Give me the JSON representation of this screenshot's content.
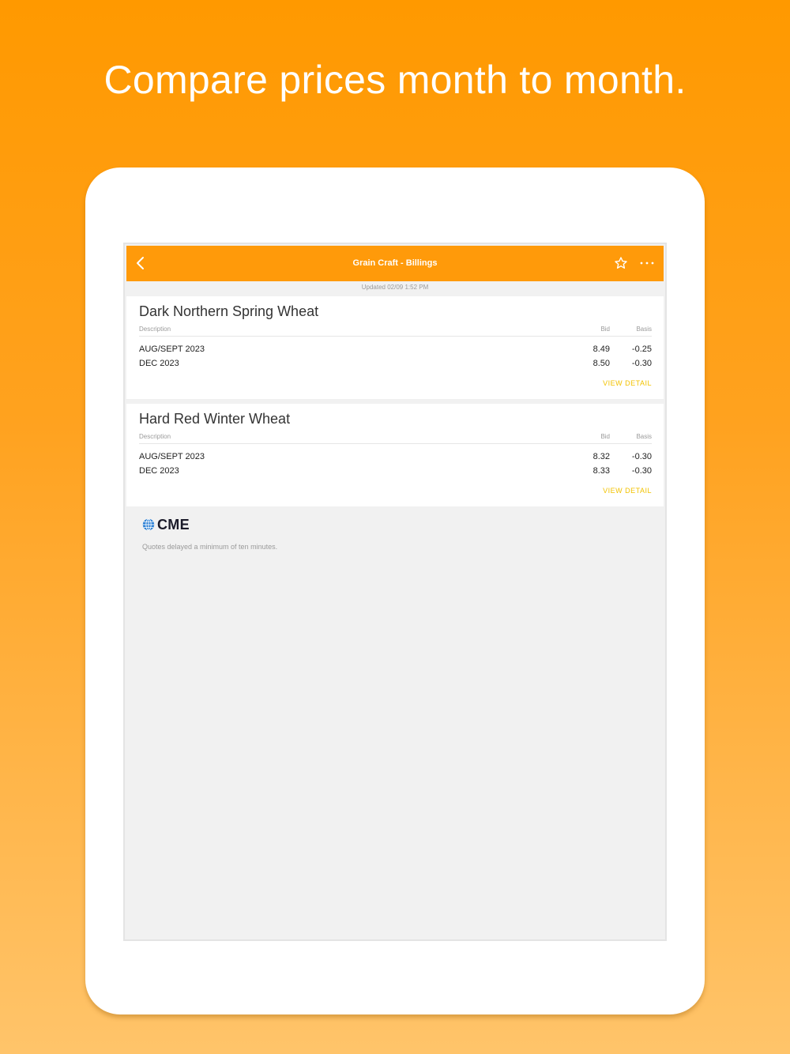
{
  "headline": "Compare prices month to month.",
  "navbar": {
    "title": "Grain Craft - Billings",
    "background": "#ff9a0a"
  },
  "updated": "Updated 02/09 1:52 PM",
  "columns": {
    "description": "Description",
    "bid": "Bid",
    "basis": "Basis"
  },
  "cards": [
    {
      "title": "Dark Northern Spring Wheat",
      "rows": [
        {
          "description": "AUG/SEPT 2023",
          "bid": "8.49",
          "basis": "-0.25"
        },
        {
          "description": "DEC 2023",
          "bid": "8.50",
          "basis": "-0.30"
        }
      ],
      "action": "VIEW DETAIL"
    },
    {
      "title": "Hard Red Winter Wheat",
      "rows": [
        {
          "description": "AUG/SEPT 2023",
          "bid": "8.32",
          "basis": "-0.30"
        },
        {
          "description": "DEC 2023",
          "bid": "8.33",
          "basis": "-0.30"
        }
      ],
      "action": "VIEW DETAIL"
    }
  ],
  "footer": {
    "logo_text": "CME",
    "disclaimer": "Quotes delayed a minimum of ten minutes."
  },
  "colors": {
    "accent": "#ff9a0a",
    "link": "#f2c200",
    "logo_blue": "#2a7fd4"
  },
  "icons": [
    "back-chevron-icon",
    "star-icon",
    "more-icon",
    "cme-globe-icon"
  ]
}
